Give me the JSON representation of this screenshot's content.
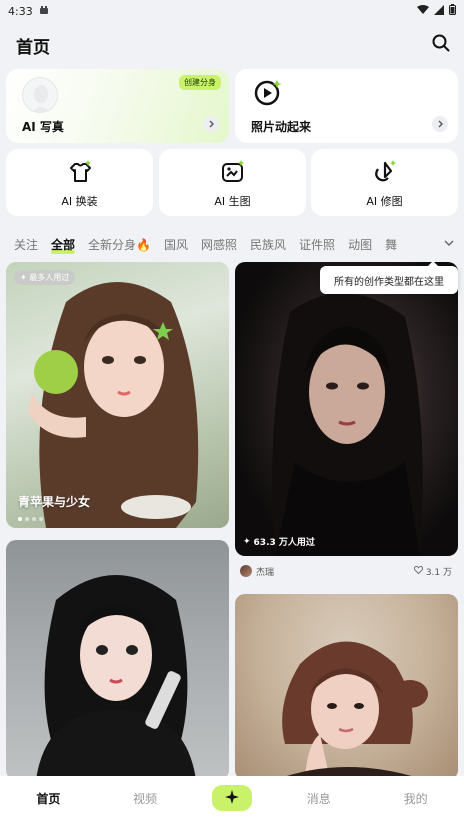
{
  "status_bar": {
    "time": "4:33"
  },
  "header": {
    "title": "首页"
  },
  "features": {
    "ai_photo": {
      "label": "AI 写真",
      "badge": "创建分身"
    },
    "photo_animate": {
      "label": "照片动起来"
    },
    "tools": [
      {
        "label": "AI 换装",
        "icon": "shirt-icon"
      },
      {
        "label": "AI 生图",
        "icon": "image-gen-icon"
      },
      {
        "label": "AI 修图",
        "icon": "retouch-icon"
      }
    ]
  },
  "tabs": [
    "关注",
    "全部",
    "全新分身",
    "国风",
    "网感照",
    "民族风",
    "证件照",
    "动图",
    "舞"
  ],
  "active_tab": "全部",
  "tooltip": "所有的创作类型都在这里",
  "feed": [
    {
      "badge": "最多人用过",
      "title": "青苹果与少女",
      "dots": 4,
      "active_dot": 0
    },
    {
      "users": "63.3 万人用过",
      "author": "杰瑞",
      "likes": "3.1 万"
    },
    {},
    {}
  ],
  "bottom_nav": {
    "items": [
      "首页",
      "视频",
      "消息",
      "我的"
    ],
    "active": "首页"
  },
  "colors": {
    "accent": "#c9f26a",
    "background": "#f1f2f5"
  }
}
